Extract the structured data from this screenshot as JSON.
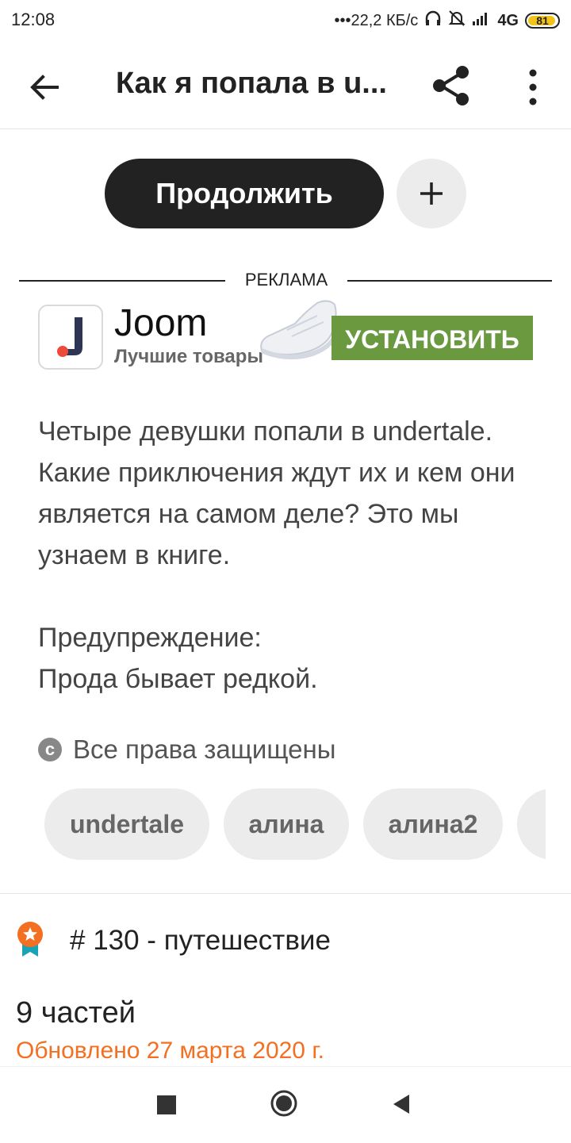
{
  "status_bar": {
    "time": "12:08",
    "network_speed": "•••22,2 КБ/с",
    "network_type": "4G",
    "battery_level": "81"
  },
  "app_bar": {
    "title": "Как я попала в u...",
    "back_icon": "arrow-left-icon",
    "share_icon": "share-icon",
    "more_icon": "more-vertical-icon"
  },
  "actions": {
    "continue_label": "Продолжить",
    "add_icon": "plus-icon"
  },
  "ad": {
    "label": "РЕКЛАМА",
    "app_name": "Joom",
    "app_tagline": "Лучшие товары",
    "install_label": "УСТАНОВИТЬ",
    "install_color": "#6a9940"
  },
  "description": {
    "line1": "Четыре девушки попали в undertale. Какие приключения ждут их и кем они является на самом деле? Это мы узнаем в книге.",
    "line2": "Предупреждение:",
    "line3": "Прода бывает редкой."
  },
  "rights": {
    "text": "Все права защищены",
    "icon": "copyright-icon"
  },
  "tags": [
    "undertale",
    "алина",
    "алина2",
    ""
  ],
  "ranking": {
    "icon": "rank-badge-icon",
    "text": "# 130 - путешествие"
  },
  "story_info": {
    "parts": "9 частей",
    "updated": "Обновлено 27 марта 2020 г.",
    "updated_color": "#f36f21"
  },
  "nav_bar": {
    "recents_icon": "square-icon",
    "home_icon": "circle-icon",
    "back_icon": "triangle-back-icon"
  }
}
